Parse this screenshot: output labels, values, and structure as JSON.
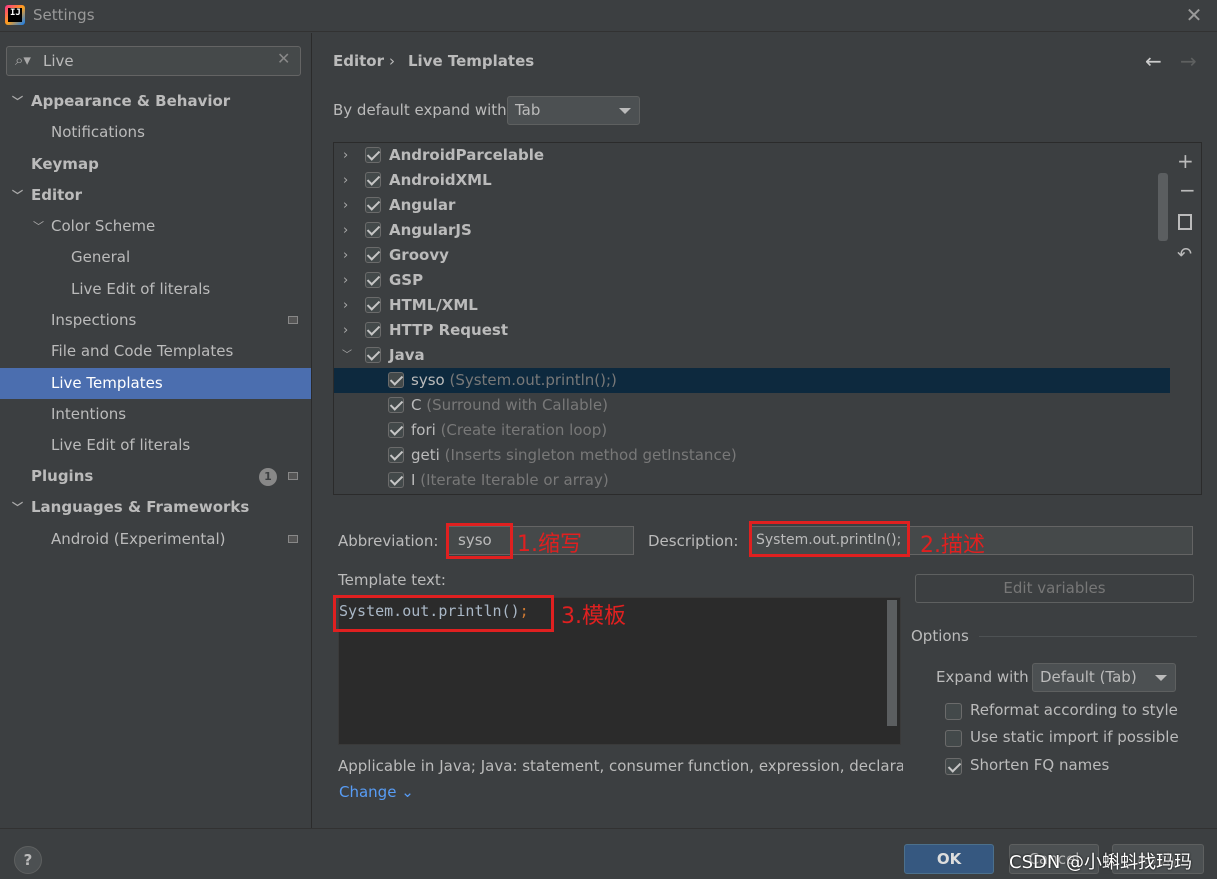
{
  "window": {
    "title": "Settings",
    "app_icon_text": "IJ"
  },
  "search": {
    "value": "Live"
  },
  "sidebar": {
    "items": [
      {
        "label": "Appearance & Behavior",
        "expanded": true
      },
      {
        "label": "Notifications"
      },
      {
        "label": "Keymap"
      },
      {
        "label": "Editor",
        "expanded": true
      },
      {
        "label": "Color Scheme",
        "expanded": true
      },
      {
        "label": "General"
      },
      {
        "label": "Live Edit of literals"
      },
      {
        "label": "Inspections"
      },
      {
        "label": "File and Code Templates"
      },
      {
        "label": "Live Templates",
        "selected": true
      },
      {
        "label": "Intentions"
      },
      {
        "label": "Live Edit of literals"
      },
      {
        "label": "Plugins",
        "badge": "1"
      },
      {
        "label": "Languages & Frameworks",
        "expanded": true
      },
      {
        "label": "Android (Experimental)"
      }
    ]
  },
  "breadcrumb": {
    "parent": "Editor",
    "separator": "›",
    "current": "Live Templates"
  },
  "expand_default": {
    "label": "By default expand with",
    "value": "Tab"
  },
  "template_groups": [
    {
      "name": "AndroidParcelable",
      "checked": true
    },
    {
      "name": "AndroidXML",
      "checked": true
    },
    {
      "name": "Angular",
      "checked": true
    },
    {
      "name": "AngularJS",
      "checked": true
    },
    {
      "name": "Groovy",
      "checked": true
    },
    {
      "name": "GSP",
      "checked": true
    },
    {
      "name": "HTML/XML",
      "checked": true
    },
    {
      "name": "HTTP Request",
      "checked": true
    },
    {
      "name": "Java",
      "checked": true,
      "expanded": true
    }
  ],
  "java_templates": [
    {
      "abbr": "syso",
      "desc": "(System.out.println();)",
      "checked": true,
      "selected": true
    },
    {
      "abbr": "C",
      "desc": "(Surround with Callable)",
      "checked": true
    },
    {
      "abbr": "fori",
      "desc": "(Create iteration loop)",
      "checked": true
    },
    {
      "abbr": "geti",
      "desc": "(Inserts singleton method getInstance)",
      "checked": true
    },
    {
      "abbr": "I",
      "desc": "(Iterate Iterable or array)",
      "checked": true
    }
  ],
  "form": {
    "abbreviation_label": "Abbreviation:",
    "abbreviation_value": "syso",
    "description_label": "Description:",
    "description_value": "System.out.println();",
    "template_text_label": "Template text:",
    "template_code": "System.out.println()",
    "template_code_semicolon": ";",
    "edit_variables": "Edit variables",
    "options_label": "Options",
    "expand_with_label": "Expand with",
    "expand_with_value": "Default (Tab)",
    "options": [
      {
        "label": "Reformat according to style",
        "checked": false
      },
      {
        "label": "Use static import if possible",
        "checked": false
      },
      {
        "label": "Shorten FQ names",
        "checked": true
      }
    ],
    "applicable": "Applicable in Java; Java: statement, consumer function, expression, declaratio.",
    "change_link": "Change ⌄"
  },
  "annotations": {
    "abbr": "1.缩写",
    "desc": "2.描述",
    "template": "3.模板",
    "color": "#e02020"
  },
  "buttons": {
    "help": "?",
    "ok": "OK",
    "cancel": "Cancel",
    "apply": "Apply"
  },
  "watermark": "CSDN @小蝌蚪找玛玛",
  "colors": {
    "selection": "#4b6eaf",
    "list_selection": "#0d293e",
    "ok_button": "#365880",
    "link": "#589df6"
  }
}
